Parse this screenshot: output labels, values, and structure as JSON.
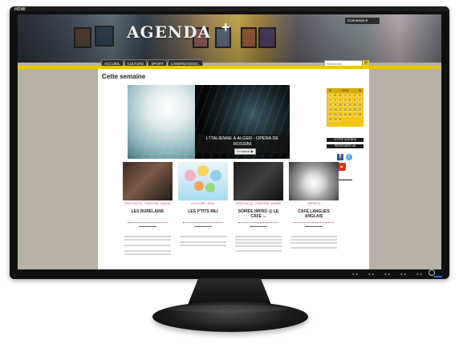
{
  "monitor": {
    "input_label": "HDMI",
    "controls": [
      "◄ ►",
      "◄ ►",
      "◄ ►",
      "◄ ►",
      "◄ ►"
    ]
  },
  "site": {
    "logo": "AGENDA",
    "connexion_label": "Connexion",
    "nav": [
      "ACCUEIL",
      "CULTURE",
      "SPORT",
      "LOISIRS/ASSOC."
    ],
    "search_placeholder": "Recherche...",
    "page_title": "Cette semaine"
  },
  "hero": {
    "title": "L'ITALIENNE À ALGER - OPÉRA DE ROSSINI",
    "button_label": "En savoir ▶"
  },
  "calendar": {
    "month": "2016",
    "days": [
      "L",
      "M",
      "M",
      "J",
      "V",
      "S",
      "D",
      "1",
      "2",
      "3",
      "4",
      "5",
      "6",
      "7",
      "8",
      "9",
      "10",
      "11",
      "12",
      "13",
      "14",
      "15",
      "16",
      "17",
      "18",
      "19",
      "20",
      "21",
      "22",
      "23",
      "24",
      "25",
      "26",
      "27",
      "28",
      "29",
      "30",
      "31",
      "",
      "",
      "",
      ""
    ]
  },
  "sidebar": {
    "button1": "VOTRE AGENDA",
    "button2": "PROPOSER UN ÉVÉNEMENT"
  },
  "events": [
    {
      "tag": "SPECTACLE, THÉÂTRE, HAUGE",
      "title": "LES BURELAINS"
    },
    {
      "tag": "LECTURE, JEUX",
      "title": "LES P'TITS RILI"
    },
    {
      "tag": "SPECTACLE, THÉÂTRE, DANSE",
      "title": "SOIRÉE IMPRO @ LE CAFÉ ..."
    },
    {
      "tag": "APPROS",
      "title": "CAFÉ LANGUES ANGLAIS"
    }
  ]
}
